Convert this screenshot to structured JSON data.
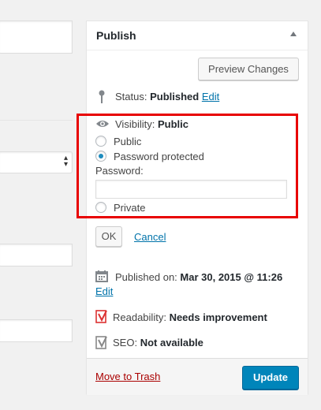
{
  "publish": {
    "title": "Publish",
    "preview_label": "Preview Changes",
    "status_label": "Status:",
    "status_value": "Published",
    "edit_label": "Edit",
    "visibility_label": "Visibility:",
    "visibility_value": "Public",
    "options": [
      "Public",
      "Password protected",
      "Private"
    ],
    "selected_option": "Password protected",
    "password_label": "Password:",
    "password_value": "",
    "ok_label": "OK",
    "cancel_label": "Cancel",
    "published_on_label": "Published on:",
    "published_on_value": "Mar 30, 2015 @ 11:26",
    "readability_label": "Readability:",
    "readability_value": "Needs improvement",
    "seo_label": "SEO:",
    "seo_value": "Not available",
    "trash_label": "Move to Trash",
    "update_label": "Update"
  },
  "colors": {
    "accent": "#0085ba",
    "link": "#0073aa",
    "trash": "#aa0000",
    "highlight": "#e80000"
  },
  "icons": [
    "pin-icon",
    "eye-icon",
    "calendar-icon",
    "yoast-readability-icon",
    "yoast-seo-icon",
    "collapse-arrow-icon"
  ]
}
